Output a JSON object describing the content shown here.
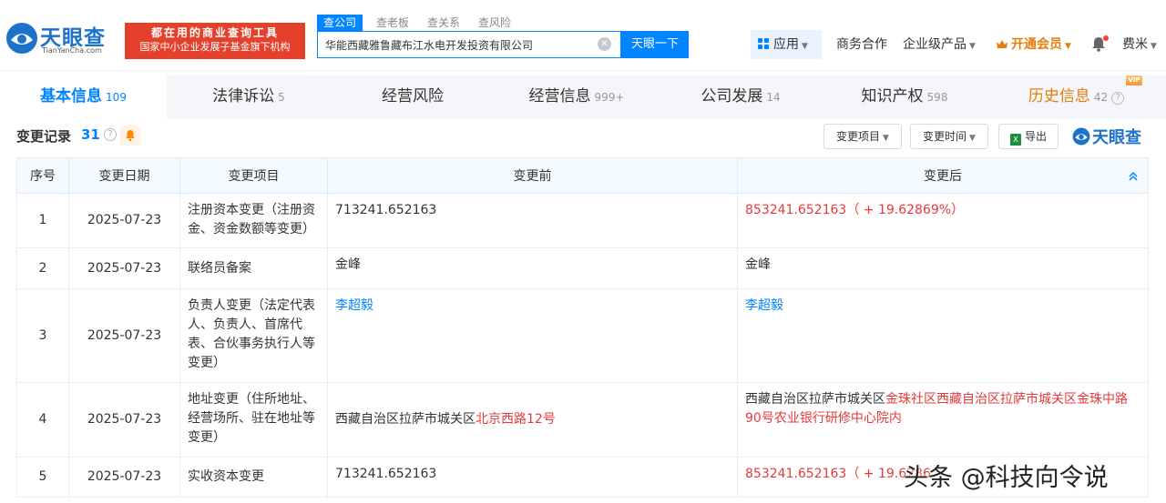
{
  "brand": {
    "name": "天眼查",
    "domain": "TianYanCha.com",
    "slogan_line1": "都在用的商业查询工具",
    "slogan_line2": "国家中小企业发展子基金旗下机构",
    "color": "#1d73c9"
  },
  "search": {
    "tabs": [
      "查公司",
      "查老板",
      "查关系",
      "查风险"
    ],
    "active_tab": 0,
    "query": "华能西藏雅鲁藏布江水电开发投资有限公司",
    "button_label": "天眼一下"
  },
  "nav": {
    "apps_label": "应用",
    "business_label": "商务合作",
    "enterprise_label": "企业级产品",
    "vip_label": "开通会员",
    "user_name": "费米"
  },
  "tabs": [
    {
      "label": "基本信息",
      "count": "109"
    },
    {
      "label": "法律诉讼",
      "count": "5"
    },
    {
      "label": "经营风险",
      "count": ""
    },
    {
      "label": "经营信息",
      "count": "999+"
    },
    {
      "label": "公司发展",
      "count": "14"
    },
    {
      "label": "知识产权",
      "count": "598"
    },
    {
      "label": "历史信息",
      "count": "42",
      "tag": "VIP"
    }
  ],
  "section": {
    "title": "变更记录",
    "count": "31",
    "filter_item_label": "变更项目",
    "filter_time_label": "变更时间",
    "export_label": "导出",
    "brand_mark": "天眼查"
  },
  "table": {
    "headers": [
      "序号",
      "变更日期",
      "变更项目",
      "变更前",
      "变更后"
    ],
    "rows": [
      {
        "idx": "1",
        "date": "2025-07-23",
        "item": "注册资本变更（注册资金、资金数额等变更）",
        "before": "713241.652163",
        "after_plain": "",
        "after_red": "853241.652163（ + 19.62869%）"
      },
      {
        "idx": "2",
        "date": "2025-07-23",
        "item": "联络员备案",
        "before": "金峰",
        "after_plain": "金峰",
        "after_red": ""
      },
      {
        "idx": "3",
        "date": "2025-07-23",
        "item": "负责人变更（法定代表人、负责人、首席代表、合伙事务执行人等变更）",
        "before_link": "李超毅",
        "after_link": "李超毅"
      },
      {
        "idx": "4",
        "date": "2025-07-23",
        "item": "地址变更（住所地址、经营场所、驻在地址等变更）",
        "before_plain": "西藏自治区拉萨市城关区",
        "before_red": "北京西路12号",
        "after_plain": "西藏自治区拉萨市城关区",
        "after_red": "金珠社区西藏自治区拉萨市城关区金珠中路90号农业银行研修中心院内"
      },
      {
        "idx": "5",
        "date": "2025-07-23",
        "item": "实收资本变更",
        "before": "713241.652163",
        "after_plain": "",
        "after_red": "853241.652163（ + 19.6286"
      }
    ]
  },
  "watermark": "头条 @科技向令说",
  "colors": {
    "primary": "#0084ff",
    "danger": "#e4393c",
    "vip": "#e57e0c",
    "slogan_bg": "#e5402b"
  }
}
